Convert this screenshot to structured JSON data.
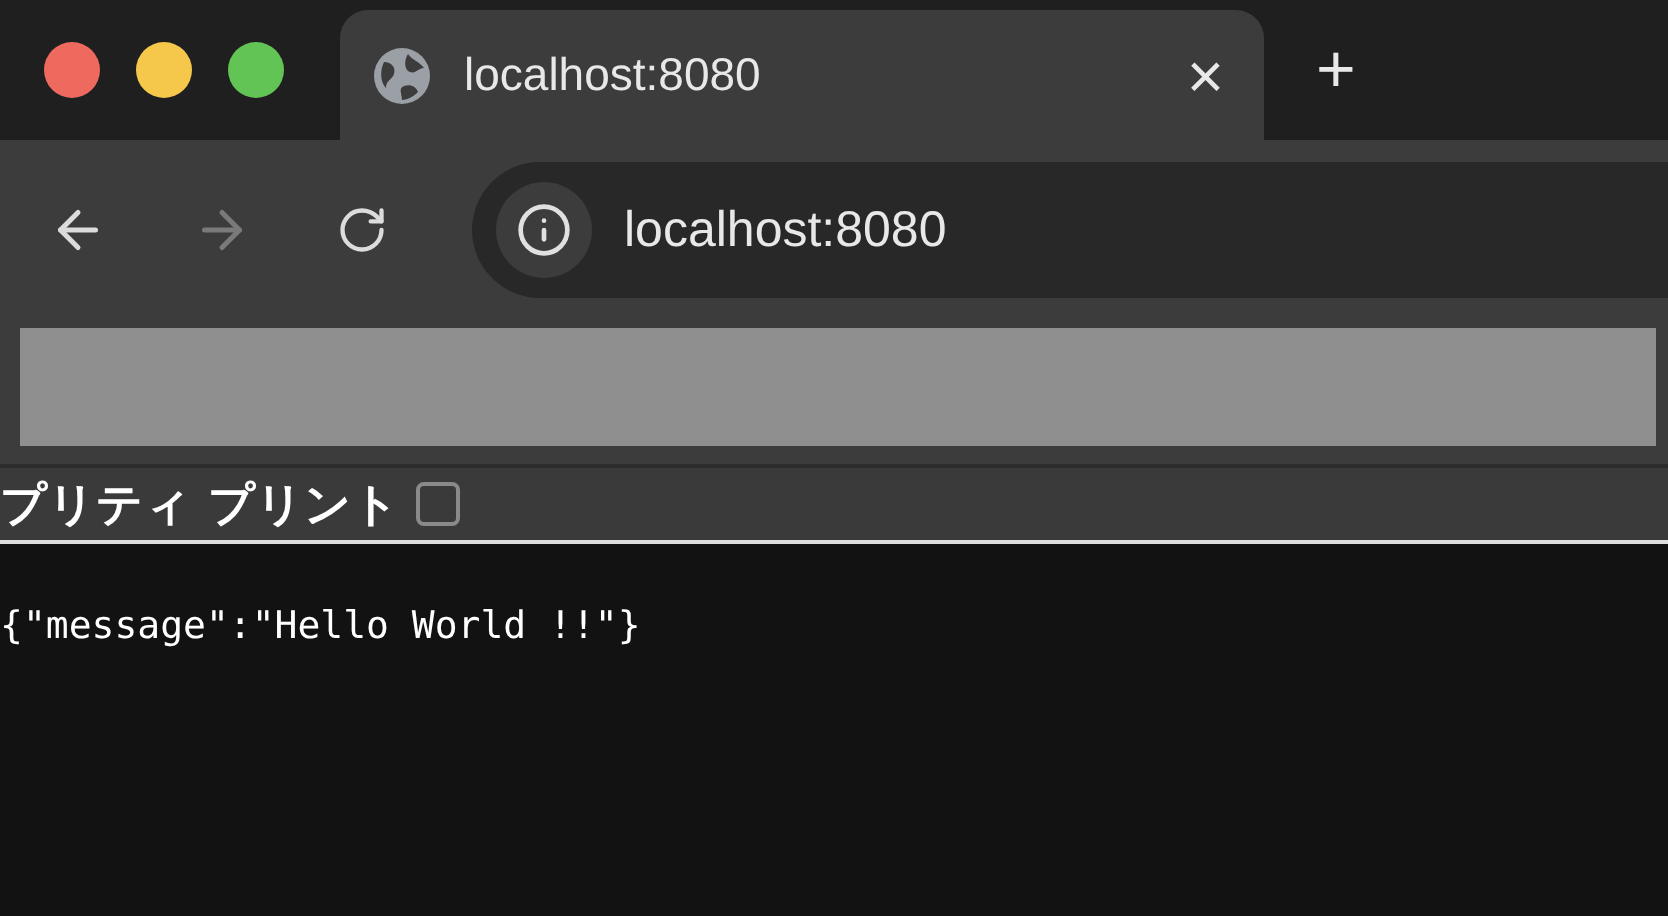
{
  "tab": {
    "title": "localhost:8080",
    "close": "×",
    "new_tab": "+"
  },
  "address_bar": {
    "url": "localhost:8080"
  },
  "nav": {
    "back_disabled": false,
    "forward_disabled": true
  },
  "pretty_print": {
    "label": "プリティ プリント",
    "checked": false
  },
  "body": {
    "text": "{\"message\":\"Hello World !!\"}"
  }
}
